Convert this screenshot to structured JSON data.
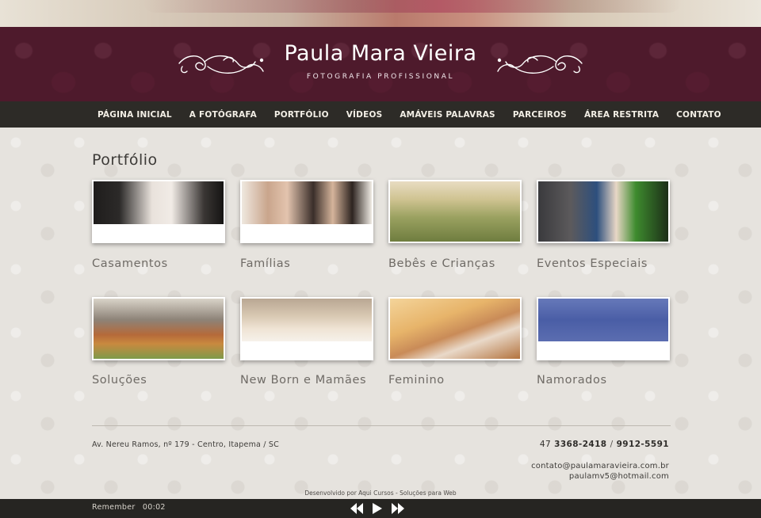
{
  "header": {
    "title": "Paula Mara Vieira",
    "subtitle": "FOTOGRAFIA PROFISSIONAL"
  },
  "nav": {
    "items": [
      {
        "label": "PÁGINA INICIAL"
      },
      {
        "label": "A FOTÓGRAFA"
      },
      {
        "label": "PORTFÓLIO"
      },
      {
        "label": "VÍDEOS"
      },
      {
        "label": "AMÁVEIS PALAVRAS"
      },
      {
        "label": "PARCEIROS"
      },
      {
        "label": "ÁREA RESTRITA"
      },
      {
        "label": "CONTATO"
      }
    ]
  },
  "page": {
    "title": "Portfólio"
  },
  "gallery": {
    "items": [
      {
        "label": "Casamentos"
      },
      {
        "label": "Famílias"
      },
      {
        "label": "Bebês e Crianças"
      },
      {
        "label": "Eventos Especiais"
      },
      {
        "label": "Soluções"
      },
      {
        "label": "New Born e Mamães"
      },
      {
        "label": "Feminino"
      },
      {
        "label": "Namorados"
      }
    ]
  },
  "footer": {
    "address": "Av. Nereu Ramos, nº 179 - Centro, Itapema / SC",
    "phone_prefix": "47",
    "phone1": "3368-2418",
    "separator": "/",
    "phone2": "9912-5591",
    "email1": "contato@paulamaravieira.com.br",
    "email2": "paulamv5@hotmail.com",
    "credit": "Desenvolvido por Aqui Cursos - Soluções para Web"
  },
  "player": {
    "track": "Remember",
    "time": "00:02"
  },
  "colors": {
    "header_bg": "#4e1a2c",
    "nav_bg": "#2d2b27",
    "page_bg": "#e6e3de"
  }
}
